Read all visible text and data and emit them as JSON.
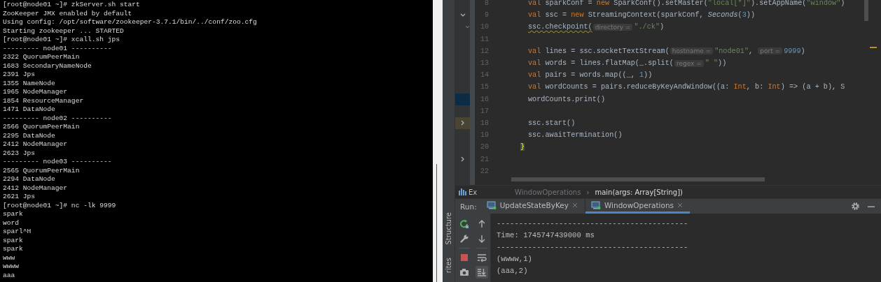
{
  "terminal": {
    "lines": [
      "[root@node01 ~]# zkServer.sh start",
      "ZooKeeper JMX enabled by default",
      "Using config: /opt/software/zookeeper-3.7.1/bin/../conf/zoo.cfg",
      "Starting zookeeper ... STARTED",
      "[root@node01 ~]# xcall.sh jps",
      "--------- node01 ----------",
      "2322 QuorumPeerMain",
      "1683 SecondaryNameNode",
      "2391 Jps",
      "1355 NameNode",
      "1965 NodeManager",
      "1854 ResourceManager",
      "1471 DataNode",
      "--------- node02 ----------",
      "2566 QuorumPeerMain",
      "2295 DataNode",
      "2412 NodeManager",
      "2623 Jps",
      "--------- node03 ----------",
      "2565 QuorumPeerMain",
      "2294 DataNode",
      "2412 NodeManager",
      "2621 Jps",
      "[root@node01 ~]# nc -lk 9999",
      "spark",
      "word",
      "sparl^H",
      "spark",
      "spark",
      "www",
      "wwww",
      "aaa"
    ]
  },
  "side_strip": {
    "labels": [
      "Structure",
      "rites"
    ]
  },
  "editor": {
    "lines": [
      {
        "number": "8",
        "kind": "statement",
        "tokens": [
          {
            "kind": "kw",
            "text": "val "
          },
          {
            "kind": "plain",
            "text": "sparkConf = "
          },
          {
            "kind": "kw",
            "text": "new "
          },
          {
            "kind": "plain",
            "text": "SparkConf().setMaster("
          },
          {
            "kind": "str",
            "text": "\"local[*]\""
          },
          {
            "kind": "plain",
            "text": ").setAppName("
          },
          {
            "kind": "str",
            "text": "\"window\""
          },
          {
            "kind": "plain",
            "text": ")"
          }
        ]
      },
      {
        "number": "9",
        "kind": "statement",
        "gutter": {
          "kind": "chevron-down"
        },
        "tokens": [
          {
            "kind": "kw",
            "text": "val "
          },
          {
            "kind": "plain",
            "text": "ssc = "
          },
          {
            "kind": "kw",
            "text": "new "
          },
          {
            "kind": "plain",
            "text": "StreamingContext(sparkConf, "
          },
          {
            "kind": "italic",
            "text": "Seconds"
          },
          {
            "kind": "plain",
            "text": "("
          },
          {
            "kind": "num",
            "text": "3"
          },
          {
            "kind": "plain",
            "text": "))"
          }
        ]
      },
      {
        "number": "10",
        "kind": "statement",
        "gutter": {
          "kind": "fold-down"
        },
        "tokens": [
          {
            "kind": "warn",
            "text": "ssc.checkpoint("
          },
          {
            "kind": "hint",
            "text": "directory ="
          },
          {
            "kind": "str",
            "text": "\"./ck\""
          },
          {
            "kind": "plain",
            "text": ")"
          }
        ]
      },
      {
        "number": "11",
        "kind": "statement"
      },
      {
        "number": "12",
        "kind": "statement",
        "tokens": [
          {
            "kind": "kw",
            "text": "val "
          },
          {
            "kind": "plain",
            "text": "lines = ssc.socketTextStream("
          },
          {
            "kind": "hint",
            "text": "hostname ="
          },
          {
            "kind": "str",
            "text": "\"node01\""
          },
          {
            "kind": "plain",
            "text": ", "
          },
          {
            "kind": "hint",
            "text": "port ="
          },
          {
            "kind": "num",
            "text": "9999"
          },
          {
            "kind": "plain",
            "text": ")"
          }
        ]
      },
      {
        "number": "13",
        "kind": "statement",
        "tokens": [
          {
            "kind": "kw",
            "text": "val "
          },
          {
            "kind": "plain",
            "text": "words = lines.flatMap(_.split("
          },
          {
            "kind": "hint",
            "text": "regex ="
          },
          {
            "kind": "str",
            "text": "\" \""
          },
          {
            "kind": "plain",
            "text": "))"
          }
        ]
      },
      {
        "number": "14",
        "kind": "statement",
        "tokens": [
          {
            "kind": "kw",
            "text": "val "
          },
          {
            "kind": "plain",
            "text": "pairs = words.map((_, "
          },
          {
            "kind": "num",
            "text": "1"
          },
          {
            "kind": "plain",
            "text": "))"
          }
        ]
      },
      {
        "number": "15",
        "kind": "statement",
        "tokens": [
          {
            "kind": "kw",
            "text": "val "
          },
          {
            "kind": "plain",
            "text": "wordCounts = pairs.reduceByKeyAndWindow((a: "
          },
          {
            "kind": "kw",
            "text": "Int"
          },
          {
            "kind": "plain",
            "text": ", b: "
          },
          {
            "kind": "kw",
            "text": "Int"
          },
          {
            "kind": "plain",
            "text": ") => (a + b), S"
          }
        ]
      },
      {
        "number": "16",
        "kind": "statement",
        "gutter": {
          "kind": "highlight"
        },
        "tokens": [
          {
            "kind": "plain",
            "text": "wordCounts.print()"
          }
        ]
      },
      {
        "number": "17",
        "kind": "statement"
      },
      {
        "number": "18",
        "kind": "statement",
        "gutter": {
          "kind": "chevron-right-highlight"
        },
        "tokens": [
          {
            "kind": "plain",
            "text": "ssc.start()"
          }
        ]
      },
      {
        "number": "19",
        "kind": "statement",
        "tokens": [
          {
            "kind": "plain",
            "text": "ssc.awaitTermination()"
          }
        ]
      },
      {
        "number": "20",
        "kind": "closing",
        "tokens": [
          {
            "kind": "brace",
            "text": "}"
          }
        ]
      },
      {
        "number": "21",
        "kind": "statement",
        "gutter": {
          "kind": "chevron-right"
        }
      },
      {
        "number": "22",
        "kind": "statement"
      }
    ]
  },
  "breadcrumb": {
    "tool_tab": "Ex",
    "items": [
      "WindowOperations",
      "main(args: Array[String])"
    ],
    "separator": "›"
  },
  "run": {
    "label": "Run:",
    "tabs": [
      {
        "label": "UpdateStateByKey",
        "selected": false
      },
      {
        "label": "WindowOperations",
        "selected": true
      }
    ]
  },
  "run_actions": [
    {
      "kind": "rerun"
    },
    {
      "kind": "wrench"
    },
    {
      "kind": "stop"
    },
    {
      "kind": "camera"
    }
  ],
  "console_tools": [
    {
      "kind": "up",
      "selected": false
    },
    {
      "kind": "down",
      "selected": false
    },
    {
      "kind": "wrap",
      "selected": false
    },
    {
      "kind": "scroll-end",
      "selected": true
    }
  ],
  "console": {
    "lines": [
      "-------------------------------------------",
      "Time: 1745747439000 ms",
      "-------------------------------------------",
      "(wwww,1)",
      "(aaa,2)"
    ]
  }
}
